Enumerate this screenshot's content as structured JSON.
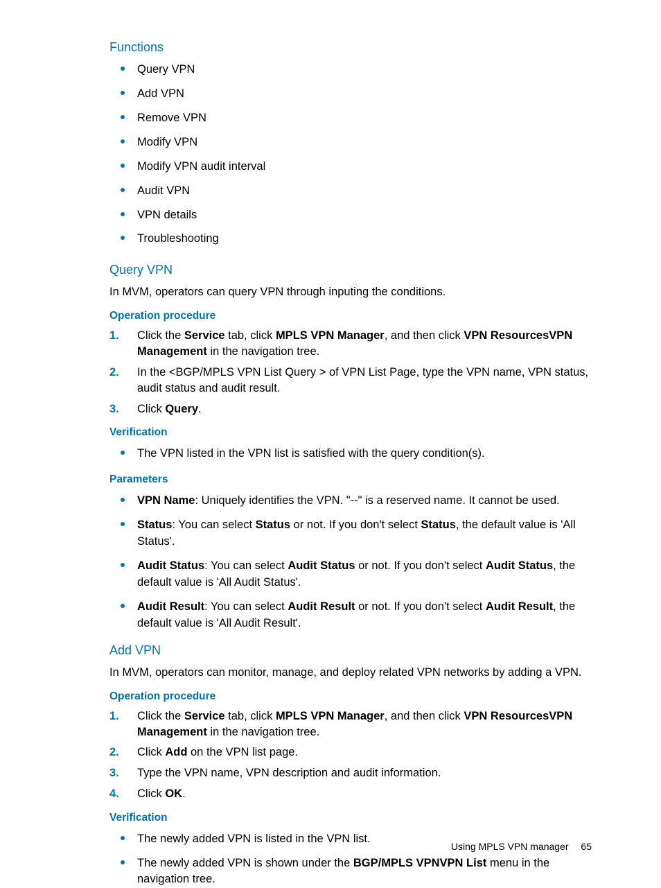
{
  "functions": {
    "heading": "Functions",
    "items": [
      "Query VPN",
      "Add VPN",
      "Remove VPN",
      "Modify VPN",
      "Modify VPN audit interval",
      "Audit VPN",
      "VPN details",
      "Troubleshooting"
    ]
  },
  "queryVPN": {
    "heading": "Query VPN",
    "intro": "In MVM, operators can query VPN through inputing the conditions.",
    "opHeading": "Operation procedure",
    "steps": {
      "s1a": "Click the ",
      "s1b": "Service",
      "s1c": " tab, click ",
      "s1d": "MPLS VPN Manager",
      "s1e": ", and then click ",
      "s1f": "VPN ResourcesVPN Management",
      "s1g": " in the navigation tree.",
      "s2": "In the <BGP/MPLS VPN List Query > of VPN List Page, type the VPN name, VPN status, audit status and audit result.",
      "s3a": "Click ",
      "s3b": "Query",
      "s3c": "."
    },
    "verHeading": "Verification",
    "verItems": [
      "The VPN listed in the VPN list is satisfied with the query condition(s)."
    ],
    "paramHeading": "Parameters",
    "params": {
      "p1a": "VPN Name",
      "p1b": ": Uniquely identifies the VPN. \"--\" is a reserved name. It cannot be used.",
      "p2a": "Status",
      "p2b": ": You can select ",
      "p2c": "Status",
      "p2d": " or not. If you don't select ",
      "p2e": "Status",
      "p2f": ", the default value is 'All Status'.",
      "p3a": "Audit Status",
      "p3b": ": You can select ",
      "p3c": "Audit Status",
      "p3d": " or not. If you don't select ",
      "p3e": "Audit Status",
      "p3f": ", the default value is 'All Audit Status'.",
      "p4a": "Audit Result",
      "p4b": ": You can select ",
      "p4c": "Audit Result",
      "p4d": " or not. If you don't select ",
      "p4e": "Audit Result",
      "p4f": ", the default value is 'All Audit Result'."
    }
  },
  "addVPN": {
    "heading": "Add VPN",
    "intro": "In MVM, operators can monitor, manage, and deploy related VPN networks by adding a VPN.",
    "opHeading": "Operation procedure",
    "steps": {
      "s1a": "Click the ",
      "s1b": "Service",
      "s1c": " tab, click ",
      "s1d": "MPLS VPN Manager",
      "s1e": ", and then click ",
      "s1f": "VPN ResourcesVPN Management",
      "s1g": " in the navigation tree.",
      "s2a": "Click ",
      "s2b": "Add",
      "s2c": " on the VPN list page.",
      "s3": "Type the VPN name, VPN description and audit information.",
      "s4a": "Click ",
      "s4b": "OK",
      "s4c": "."
    },
    "verHeading": "Verification",
    "ver": {
      "v1": "The newly added VPN is listed in the VPN list.",
      "v2a": "The newly added VPN is shown under the ",
      "v2b": "BGP/MPLS VPNVPN List",
      "v2c": " menu in the navigation tree."
    }
  },
  "footer": {
    "text": "Using MPLS VPN manager",
    "page": "65"
  }
}
